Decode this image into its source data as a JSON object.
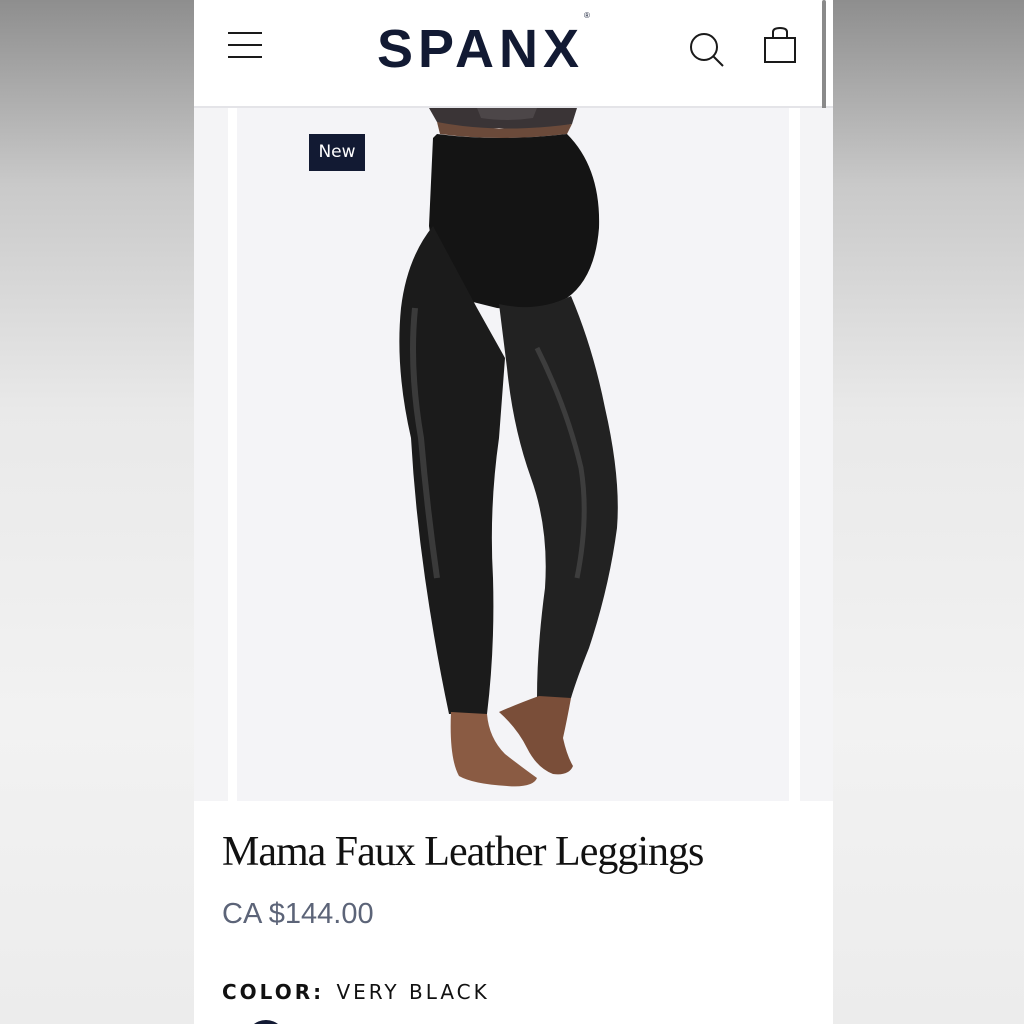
{
  "header": {
    "logo": "SPANX",
    "logo_mark": "®",
    "menu_icon": "hamburger-menu-icon",
    "search_icon": "search-icon",
    "bag_icon": "shopping-bag-icon"
  },
  "product": {
    "badge": "New",
    "title": "Mama Faux Leather Leggings",
    "price": "CA $144.00",
    "color_label": "COLOR:",
    "color_value": "VERY BLACK",
    "swatch_color": "#121a33"
  },
  "colors": {
    "brand_navy": "#121a33",
    "price_gray": "#5c6478"
  }
}
